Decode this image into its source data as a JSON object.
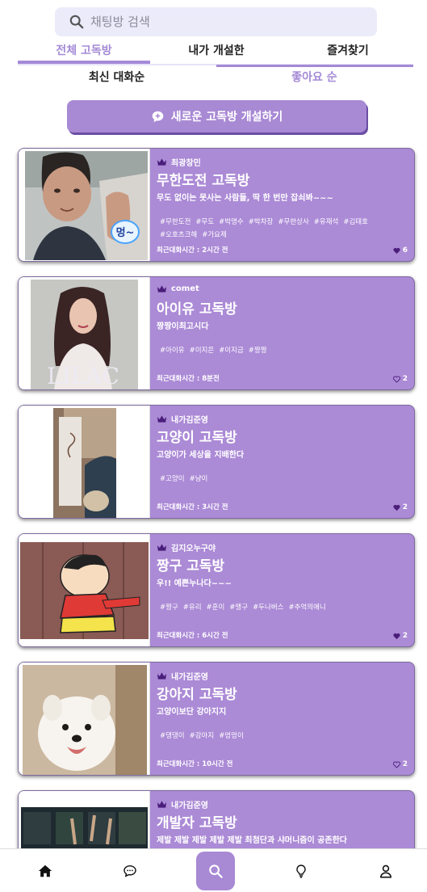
{
  "search": {
    "placeholder": "채팅방 검색"
  },
  "tabs": [
    {
      "label": "전체 고독방",
      "active": true
    },
    {
      "label": "내가 개설한",
      "active": false
    },
    {
      "label": "즐겨찾기",
      "active": false
    }
  ],
  "sort": [
    {
      "label": "최신 대화순",
      "active": false
    },
    {
      "label": "좋아요 순",
      "active": true
    }
  ],
  "new_room_label": "새로운 고독방 개설하기",
  "colors": {
    "accent": "#a889d4",
    "card": "#ab8ad6",
    "search_bg": "#ecebfa",
    "crown": "#4a1e7a"
  },
  "rooms": [
    {
      "owner": "최광창민",
      "title": "무한도전 고독방",
      "desc": "무도 없이는 못사는 사람들, 딱 한 번만 잡쇠봐~~~",
      "tags": [
        "#무한도전",
        "#무도",
        "#박명수",
        "#박차장",
        "#무한상사",
        "#유재석",
        "#김태호",
        "#오호츠크해",
        "#가요제"
      ],
      "last": "최근대화시간 : 2시간 전",
      "likes": "6",
      "liked": true,
      "image": "man-photo",
      "image_text": "멍~"
    },
    {
      "owner": "comet",
      "title": "아이유 고독방",
      "desc": "짱짱이최고시다",
      "tags": [
        "#아이유",
        "#이지은",
        "#이지금",
        "#짱짱"
      ],
      "last": "최근대화시간 : 8분전",
      "likes": "2",
      "liked": false,
      "image": "lilac-album",
      "image_text": "LILAC"
    },
    {
      "owner": "내가김준영",
      "title": "고양이 고독방",
      "desc": "고양이가 세상을 지배한다",
      "tags": [
        "#고양이",
        "#냥이"
      ],
      "last": "최근대화시간 : 3시간 전",
      "likes": "2",
      "liked": true,
      "image": "cat-photo"
    },
    {
      "owner": "김지오누구야",
      "title": "짱구 고독방",
      "desc": "우!! 예쁜누나다~~~",
      "tags": [
        "#짱구",
        "#유리",
        "#훈이",
        "#맹구",
        "#두나버스",
        "#추억의애니"
      ],
      "last": "최근대화시간 : 6시간 전",
      "likes": "2",
      "liked": true,
      "image": "cartoon-boy"
    },
    {
      "owner": "내가김준영",
      "title": "강아지 고독방",
      "desc": "고양이보단 강아지지",
      "tags": [
        "#댕댕이",
        "#강아지",
        "#멍멍이"
      ],
      "last": "최근대화시간 : 10시간 전",
      "likes": "2",
      "liked": false,
      "image": "dog-photo"
    },
    {
      "owner": "내가김준영",
      "title": "개발자 고독방",
      "desc": "제발 제발 제발 제발 제발 최첨단과 샤머니즘이 공존한다",
      "tags": [],
      "last": "",
      "likes": "",
      "liked": false,
      "image": "server-room-photo"
    }
  ],
  "nav": [
    {
      "icon": "home-icon"
    },
    {
      "icon": "chat-icon"
    },
    {
      "icon": "search-icon"
    },
    {
      "icon": "bulb-icon"
    },
    {
      "icon": "user-icon"
    }
  ]
}
